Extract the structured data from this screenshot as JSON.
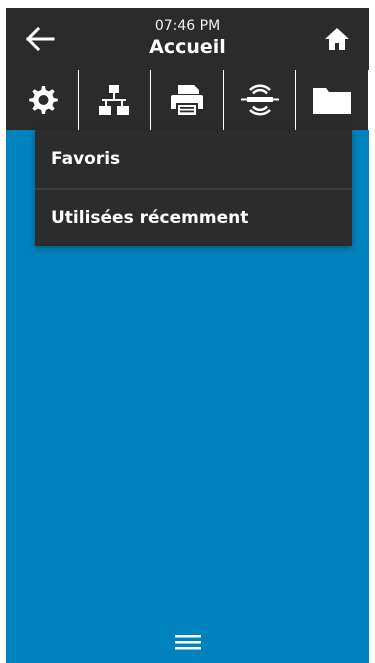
{
  "header": {
    "time": "07:46 PM",
    "title": "Accueil"
  },
  "tabs": [
    {
      "name": "settings",
      "icon": "gear-icon"
    },
    {
      "name": "network",
      "icon": "network-icon"
    },
    {
      "name": "print",
      "icon": "printer-icon"
    },
    {
      "name": "rfid",
      "icon": "rfid-icon"
    },
    {
      "name": "storage",
      "icon": "folder-icon"
    }
  ],
  "menu": {
    "items": [
      "Favoris",
      "Utilisées récemment"
    ]
  },
  "colors": {
    "header_bg": "#2b2b2b",
    "content_bg": "#0082be",
    "menu_bg": "#2c2c2c"
  }
}
